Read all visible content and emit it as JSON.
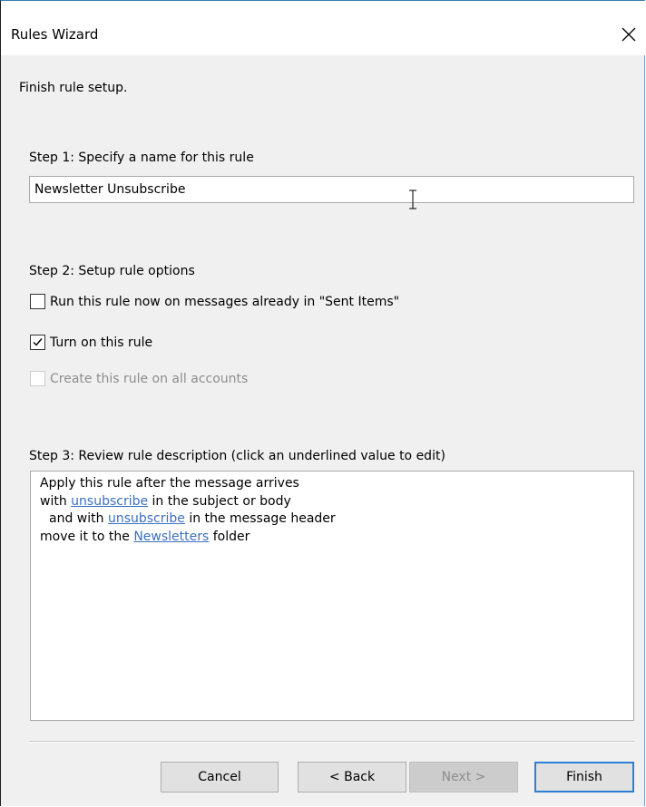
{
  "window": {
    "title": "Rules Wizard",
    "close_icon": "close-icon"
  },
  "intro": "Finish rule setup.",
  "step1": {
    "label": "Step 1: Specify a name for this rule",
    "rule_name_value": "Newsletter Unsubscribe"
  },
  "step2": {
    "label": "Step 2: Setup rule options",
    "options": [
      {
        "label": "Run this rule now on messages already in \"Sent Items\"",
        "checked": false,
        "enabled": true
      },
      {
        "label": "Turn on this rule",
        "checked": true,
        "enabled": true
      },
      {
        "label": "Create this rule on all accounts",
        "checked": false,
        "enabled": false
      }
    ]
  },
  "step3": {
    "label": "Step 3: Review rule description (click an underlined value to edit)",
    "lines": [
      {
        "prefix": "Apply this rule after the message arrives"
      },
      {
        "prefix": "with ",
        "link": "unsubscribe",
        "suffix": " in the subject or body"
      },
      {
        "prefix": "and with ",
        "link": "unsubscribe",
        "suffix": " in the message header"
      },
      {
        "prefix": "move it to the ",
        "link": "Newsletters",
        "suffix": " folder"
      }
    ]
  },
  "buttons": {
    "cancel": "Cancel",
    "back": "< Back",
    "next": "Next >",
    "finish": "Finish"
  },
  "colors": {
    "link": "#3b6fc0",
    "default_button_border": "#2b7fd6",
    "dialog_background": "#f0f0f0"
  }
}
